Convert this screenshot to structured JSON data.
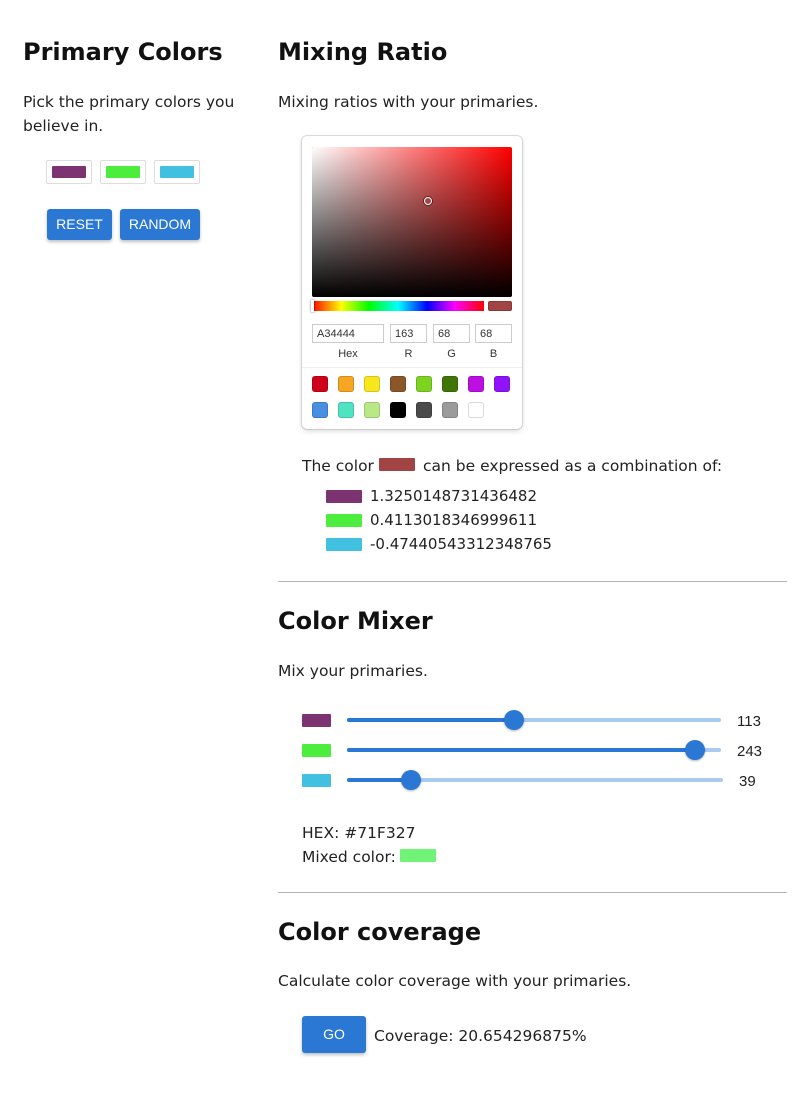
{
  "primary": {
    "title": "Primary Colors",
    "desc": "Pick the primary colors you believe in.",
    "colors": [
      "#7b3371",
      "#4ded3d",
      "#41c1df"
    ],
    "reset_label": "RESET",
    "random_label": "RANDOM"
  },
  "mixing": {
    "title": "Mixing Ratio",
    "desc": "Mixing ratios with your primaries.",
    "picker": {
      "hue_color": "#ff0000",
      "current_color": "#a34444",
      "hue_fraction": 0.0,
      "saturation_fraction": 0.58,
      "brightness_fraction": 0.64,
      "hex_value": "A34444",
      "r_value": "163",
      "g_value": "68",
      "b_value": "68",
      "labels": {
        "hex": "Hex",
        "r": "R",
        "g": "G",
        "b": "B"
      },
      "presets": [
        "#d0021b",
        "#f5a623",
        "#f8e71c",
        "#8b572a",
        "#7ed321",
        "#417505",
        "#bd10e0",
        "#9013fe",
        "#4a90e2",
        "#50e3c2",
        "#b8e986",
        "#000000",
        "#4a4a4a",
        "#9b9b9b",
        "#ffffff"
      ]
    },
    "result_prefix": "The color",
    "result_suffix": "can be expressed as a combination of:",
    "result_color": "#a34444",
    "ratios": [
      {
        "color": "#7b3371",
        "value": "1.3250148731436482"
      },
      {
        "color": "#4ded3d",
        "value": "0.4113018346999611"
      },
      {
        "color": "#41c1df",
        "value": "-0.47440543312348765"
      }
    ]
  },
  "mixer": {
    "title": "Color Mixer",
    "desc": "Mix your primaries.",
    "sliders": [
      {
        "color": "#7b3371",
        "value": 113,
        "max": 255,
        "label": "113"
      },
      {
        "color": "#4ded3d",
        "value": 243,
        "max": 255,
        "label": "243"
      },
      {
        "color": "#41c1df",
        "value": 39,
        "max": 255,
        "label": "39"
      }
    ],
    "hex_text": "HEX: #71F327",
    "mixed_label": "Mixed color:",
    "mixed_color": "#71f377"
  },
  "coverage": {
    "title": "Color coverage",
    "desc": "Calculate color coverage with your primaries.",
    "go_label": "GO",
    "result": "Coverage: 20.654296875%"
  }
}
